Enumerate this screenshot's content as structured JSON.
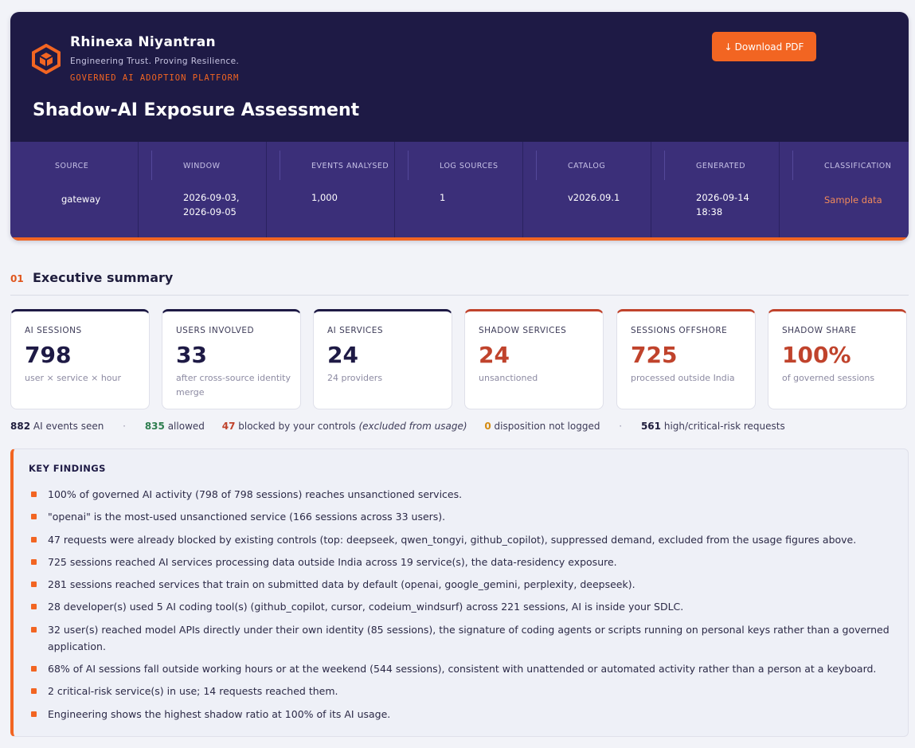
{
  "brand": {
    "name": "Rhinexa Niyantran",
    "tagline": "Engineering Trust. Proving Resilience.",
    "platform": "GOVERNED AI ADOPTION PLATFORM",
    "logo_icon": "hexagon-cube-logo",
    "accent_color": "#f26522",
    "header_bg": "#1e1a45",
    "band_bg": "#3b2f79"
  },
  "header": {
    "title": "Shadow-AI Exposure Assessment",
    "download_label": "Download PDF",
    "download_icon": "↓"
  },
  "meta": [
    {
      "label": "SOURCE",
      "value": "gateway"
    },
    {
      "label": "WINDOW",
      "value": "2026-09-03,\n2026-09-05"
    },
    {
      "label": "EVENTS ANALYSED",
      "value": "1,000"
    },
    {
      "label": "LOG SOURCES",
      "value": "1"
    },
    {
      "label": "CATALOG",
      "value": "v2026.09.1"
    },
    {
      "label": "GENERATED",
      "value": "2026-09-14\n18:38"
    },
    {
      "label": "CLASSIFICATION",
      "value": "Sample data"
    }
  ],
  "section": {
    "number": "01",
    "title": "Executive summary"
  },
  "kpis": [
    {
      "label": "AI SESSIONS",
      "value": "798",
      "sub": "user × service × hour",
      "risk": false
    },
    {
      "label": "USERS INVOLVED",
      "value": "33",
      "sub": "after cross-source identity merge",
      "risk": false
    },
    {
      "label": "AI SERVICES",
      "value": "24",
      "sub": "24 providers",
      "risk": false
    },
    {
      "label": "SHADOW SERVICES",
      "value": "24",
      "sub": "unsanctioned",
      "risk": true
    },
    {
      "label": "SESSIONS OFFSHORE",
      "value": "725",
      "sub": "processed outside India",
      "risk": true
    },
    {
      "label": "SHADOW SHARE",
      "value": "100%",
      "sub": "of governed sessions",
      "risk": true
    }
  ],
  "stats": {
    "events_seen": "882",
    "events_seen_label": "AI events seen",
    "allowed": "835",
    "allowed_label": "allowed",
    "blocked": "47",
    "blocked_label": "blocked by your controls",
    "blocked_note": "(excluded from usage)",
    "not_logged": "0",
    "not_logged_label": "disposition not logged",
    "high_risk": "561",
    "high_risk_label": "high/critical-risk requests",
    "separator": "·"
  },
  "findings": {
    "title": "KEY FINDINGS",
    "items": [
      "100% of governed AI activity (798 of 798 sessions) reaches unsanctioned services.",
      "\"openai\" is the most-used unsanctioned service (166 sessions across 33 users).",
      "47 requests were already blocked by existing controls (top: deepseek, qwen_tongyi, github_copilot), suppressed demand, excluded from the usage figures above.",
      "725 sessions reached AI services processing data outside India across 19 service(s), the data-residency exposure.",
      "281 sessions reached services that train on submitted data by default (openai, google_gemini, perplexity, deepseek).",
      "28 developer(s) used 5 AI coding tool(s) (github_copilot, cursor, codeium_windsurf) across 221 sessions, AI is inside your SDLC.",
      "32 user(s) reached model APIs directly under their own identity (85 sessions), the signature of coding agents or scripts running on personal keys rather than a governed application.",
      "68% of AI sessions fall outside working hours or at the weekend (544 sessions), consistent with unattended or automated activity rather than a person at a keyboard.",
      "2 critical-risk service(s) in use; 14 requests reached them.",
      "Engineering shows the highest shadow ratio at 100% of its AI usage."
    ]
  }
}
